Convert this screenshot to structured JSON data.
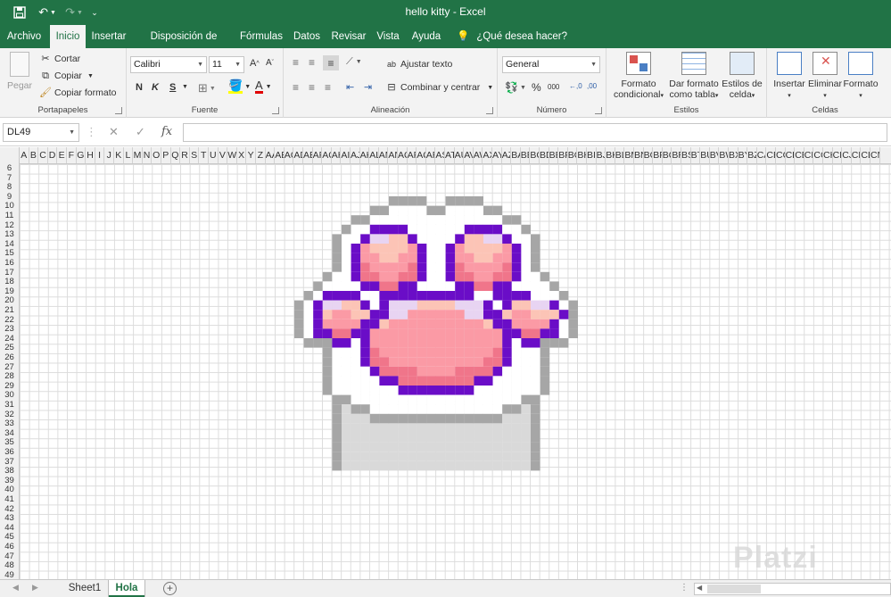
{
  "window": {
    "title": "hello kitty  -  Excel"
  },
  "quick_access": {
    "save_icon": "save-icon",
    "undo_icon": "undo-icon",
    "redo_icon": "redo-icon",
    "customize_icon": "customize-icon"
  },
  "menu": {
    "tabs": [
      {
        "label": "Archivo"
      },
      {
        "label": "Inicio"
      },
      {
        "label": "Insertar"
      },
      {
        "label": "Disposición de página"
      },
      {
        "label": "Fórmulas"
      },
      {
        "label": "Datos"
      },
      {
        "label": "Revisar"
      },
      {
        "label": "Vista"
      },
      {
        "label": "Ayuda"
      }
    ],
    "active_tab": "Inicio",
    "tell_me": "¿Qué desea hacer?"
  },
  "ribbon": {
    "clipboard": {
      "label": "Portapapeles",
      "paste": "Pegar",
      "cut": "Cortar",
      "copy": "Copiar",
      "format_painter": "Copiar formato"
    },
    "font": {
      "label": "Fuente",
      "name": "Calibri",
      "size": "11",
      "bold": "N",
      "italic": "K",
      "underline": "S"
    },
    "alignment": {
      "label": "Alineación",
      "wrap": "Ajustar texto",
      "merge": "Combinar y centrar"
    },
    "number": {
      "label": "Número",
      "format": "General",
      "percent": "%",
      "thousands": "000"
    },
    "styles": {
      "label": "Estilos",
      "conditional_1": "Formato",
      "conditional_2": "condicional",
      "table_1": "Dar formato",
      "table_2": "como tabla",
      "cell_1": "Estilos de",
      "cell_2": "celda"
    },
    "cells": {
      "label": "Celdas",
      "insert": "Insertar",
      "delete": "Eliminar",
      "format": "Formato"
    }
  },
  "formula_bar": {
    "name_box": "DL49",
    "cancel": "✕",
    "enter": "✓",
    "fx": "fx",
    "value": ""
  },
  "grid": {
    "columns": [
      "A",
      "B",
      "C",
      "D",
      "E",
      "F",
      "G",
      "H",
      "I",
      "J",
      "K",
      "L",
      "M",
      "N",
      "O",
      "P",
      "Q",
      "R",
      "S",
      "T",
      "U",
      "V",
      "W",
      "X",
      "Y",
      "Z",
      "AA",
      "AB",
      "AC",
      "AD",
      "AE",
      "AF",
      "AG",
      "AH",
      "AI",
      "AJ",
      "AK",
      "AL",
      "AM",
      "AN",
      "AO",
      "AP",
      "AQ",
      "AR",
      "AS",
      "AT",
      "AU",
      "AV",
      "AW",
      "AX",
      "AY",
      "AZ",
      "BA",
      "BB",
      "BC",
      "BD",
      "BE",
      "BF",
      "BG",
      "BH",
      "BI",
      "BJ",
      "BK",
      "BL",
      "BM",
      "BN",
      "BO",
      "BP",
      "BQ",
      "BR",
      "BS",
      "BT",
      "BU",
      "BV",
      "BW",
      "BX",
      "BY",
      "BZ",
      "CA",
      "CB",
      "CC",
      "CD",
      "CE",
      "CF",
      "CG",
      "CH",
      "CI",
      "CJ",
      "CK",
      "CL",
      "CM"
    ],
    "rows": [
      "6",
      "7",
      "8",
      "9",
      "10",
      "11",
      "12",
      "13",
      "14",
      "15",
      "16",
      "17",
      "18",
      "19",
      "20",
      "21",
      "22",
      "23",
      "24",
      "25",
      "26",
      "27",
      "28",
      "29",
      "30",
      "31",
      "32",
      "33",
      "34",
      "35",
      "36",
      "37",
      "38",
      "39",
      "40",
      "41",
      "42",
      "43",
      "44",
      "45",
      "46",
      "47",
      "48",
      "49"
    ],
    "colors": {
      "outline": "#a6a6a6",
      "purple": "#6a0dc7",
      "pink_dark": "#f0758a",
      "pink": "#fb9aa5",
      "pink_light": "#fcc4b6",
      "lavender": "#e8d4f2",
      "white": "#ffffff",
      "base": "#d9d9d9"
    }
  },
  "sheets": {
    "tabs": [
      {
        "label": "Sheet1"
      },
      {
        "label": "Hola"
      }
    ],
    "active": "Hola"
  },
  "watermark": "Platzi"
}
